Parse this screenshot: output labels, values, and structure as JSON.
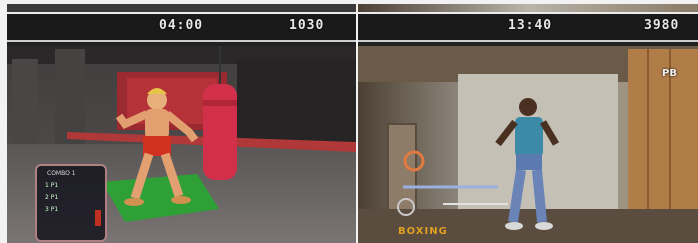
{
  "left_screen": {
    "timer": "04:00",
    "score": "1030",
    "combo_panel": {
      "title": "COMBO 1",
      "rows": [
        "1 P1",
        "2 P1",
        "3 P1"
      ]
    }
  },
  "right_screen": {
    "timer": "13:40",
    "score": "3980",
    "corner_badge": "PB",
    "fighter_label": "BOXING"
  },
  "colors": {
    "hud_bar": "#1a1a1a",
    "hud_text": "#e8e8e8",
    "punching_bag": "#d2304a",
    "floor_mat": "#2ea035",
    "shorts_red": "#d23020",
    "label_orange": "#e0a020"
  }
}
